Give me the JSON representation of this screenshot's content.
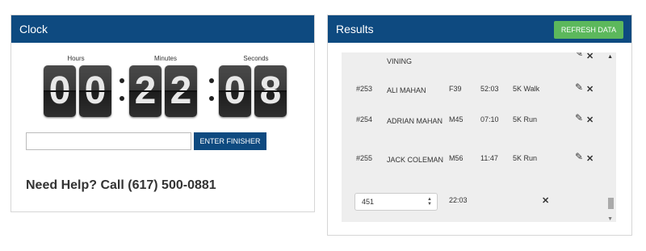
{
  "clock": {
    "title": "Clock",
    "hours_label": "Hours",
    "minutes_label": "Minutes",
    "seconds_label": "Seconds",
    "digits": [
      "0",
      "0",
      "2",
      "2",
      "0",
      "8"
    ],
    "enter_button": "ENTER FINISHER",
    "finisher_value": "",
    "help_text": "Need Help? Call (617) 500-0881"
  },
  "results": {
    "title": "Results",
    "refresh_button": "REFRESH DATA",
    "partial_top_name": "VINING",
    "rows": [
      {
        "bib": "#253",
        "name": "ALI MAHAN",
        "division": "F39",
        "time": "52:03",
        "race": "5K Walk"
      },
      {
        "bib": "#254",
        "name": "ADRIAN MAHAN",
        "division": "M45",
        "time": "07:10",
        "race": "5K Run"
      },
      {
        "bib": "#255",
        "name": "JACK COLEMAN",
        "division": "M56",
        "time": "11:47",
        "race": "5K Run"
      }
    ],
    "new_entry": {
      "bib_value": "451",
      "time": "22:03"
    }
  },
  "colors": {
    "header": "#0e4a80",
    "refresh": "#5cb85c"
  }
}
